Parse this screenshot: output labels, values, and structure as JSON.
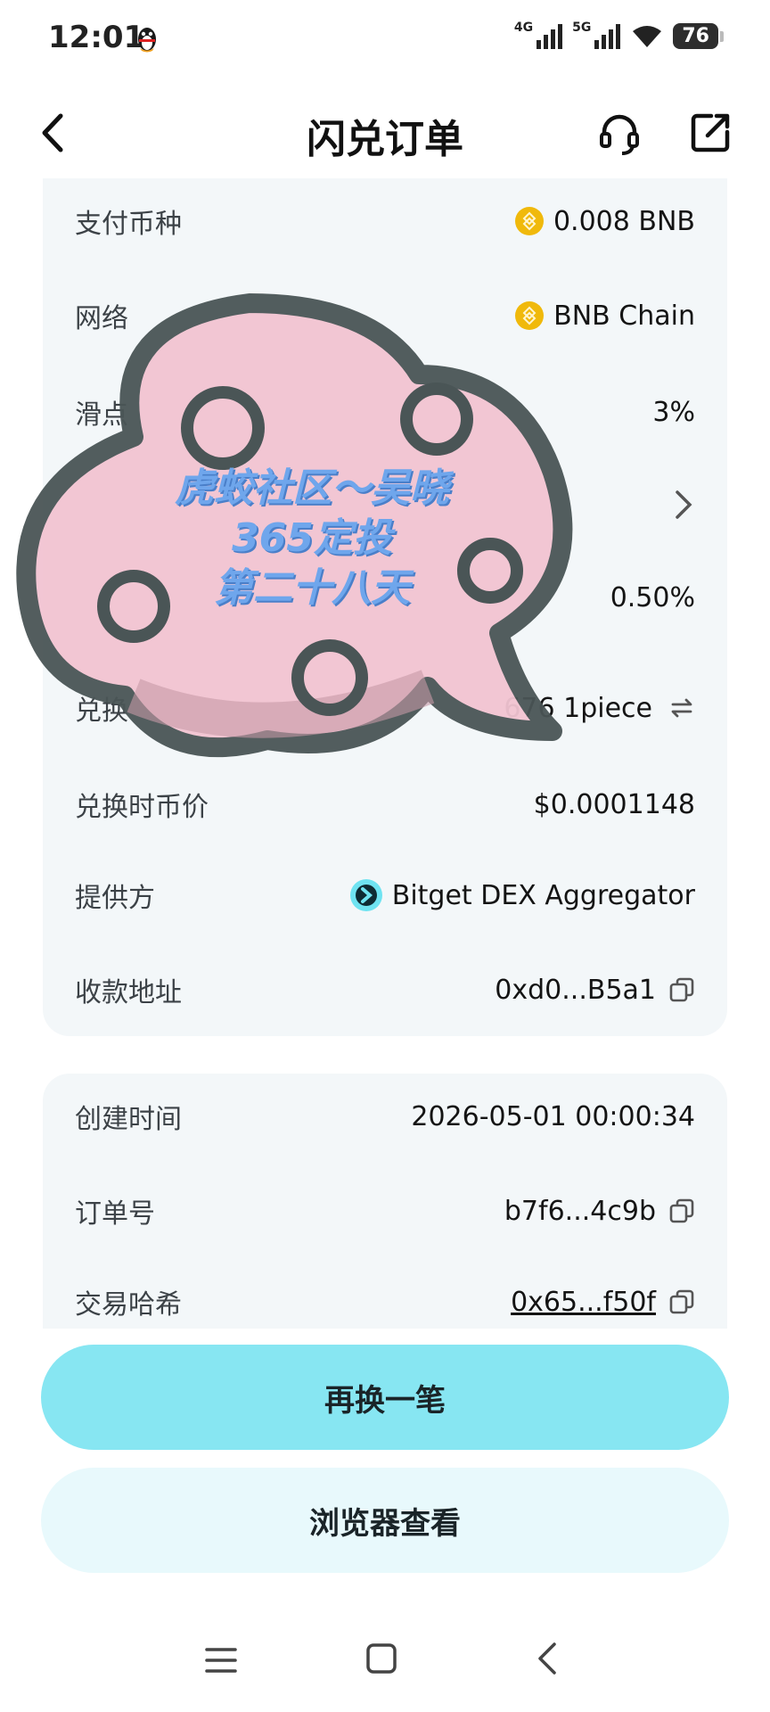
{
  "status_bar": {
    "time": "12:01",
    "network_1": "4G",
    "network_2": "5G",
    "battery": "76",
    "icons": [
      "qq-penguin-icon",
      "signal-icon",
      "wifi-icon",
      "battery-icon"
    ]
  },
  "header": {
    "title": "闪兑订单",
    "icons": [
      "back-icon",
      "headset-icon",
      "share-icon"
    ]
  },
  "details_card": {
    "rows": [
      {
        "label": "支付币种",
        "value": "0.008 BNB",
        "icon": "bnb-coin-icon"
      },
      {
        "label": "网络",
        "value": "BNB Chain",
        "icon": "bnb-coin-icon"
      },
      {
        "label": "滑点",
        "value": "3%"
      },
      {
        "label": "",
        "value": "",
        "icon": "chevron-right-icon"
      },
      {
        "label": "",
        "value": "0.50%"
      }
    ]
  },
  "exchange_card": {
    "rows": [
      {
        "label": "兑换",
        "value": "676 1piece",
        "icon": "swap-icon"
      },
      {
        "label": "兑换时币价",
        "value": "$0.0001148"
      },
      {
        "label": "提供方",
        "value": "Bitget DEX Aggregator",
        "icon": "bitget-icon"
      },
      {
        "label": "收款地址",
        "value": "0xd0...B5a1",
        "icon": "copy-icon"
      }
    ]
  },
  "order_card": {
    "rows": [
      {
        "label": "创建时间",
        "value": "2026-05-01 00:00:34"
      },
      {
        "label": "订单号",
        "value": "b7f6...4c9b",
        "icon": "copy-icon"
      },
      {
        "label": "交易哈希",
        "value": "0x65...f50f",
        "icon": "copy-icon"
      }
    ]
  },
  "buttons": {
    "primary": "再换一笔",
    "secondary": "浏览器查看"
  },
  "sticker": {
    "line1": "虎蛟社区～吴晓",
    "line2": "365定投",
    "line3": "第二十八天"
  },
  "nav_bar": {
    "icons": [
      "menu-icon",
      "home-icon",
      "back-nav-icon"
    ]
  },
  "colors": {
    "accent": "#87e6f2",
    "accent_light": "#e8f9fc",
    "card_bg": "#f3f7f9",
    "bnb": "#f0b90b",
    "sticker_pink": "#f2c4d2",
    "sticker_outline": "#4a5556",
    "sticker_text": "#6fa6ec"
  }
}
